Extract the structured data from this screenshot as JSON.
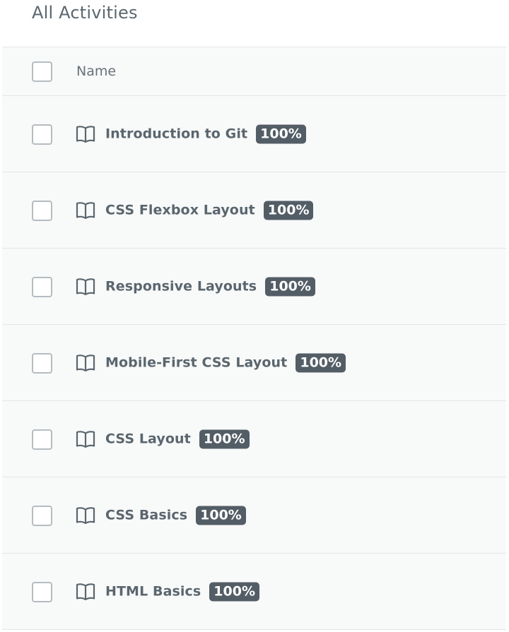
{
  "page": {
    "title": "All Activities"
  },
  "table": {
    "column_header": "Name",
    "rows": [
      {
        "name": "Introduction to Git",
        "progress": "100%",
        "icon": "book-icon"
      },
      {
        "name": "CSS Flexbox Layout",
        "progress": "100%",
        "icon": "book-icon"
      },
      {
        "name": "Responsive Layouts",
        "progress": "100%",
        "icon": "book-icon"
      },
      {
        "name": "Mobile-First CSS Layout",
        "progress": "100%",
        "icon": "book-icon"
      },
      {
        "name": "CSS Layout",
        "progress": "100%",
        "icon": "book-icon"
      },
      {
        "name": "CSS Basics",
        "progress": "100%",
        "icon": "book-icon"
      },
      {
        "name": "HTML Basics",
        "progress": "100%",
        "icon": "book-icon"
      }
    ]
  }
}
